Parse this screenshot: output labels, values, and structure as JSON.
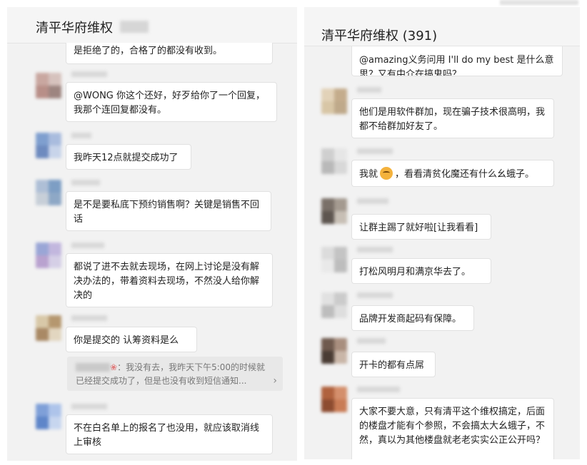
{
  "left_chat": {
    "title": "清平华府维权",
    "messages": [
      {
        "text": "是拒绝了的，合格了的都没有收到。"
      },
      {
        "text": "@WONG 你这个还好，好歹给你了一个回复，我那个连回复都没有。"
      },
      {
        "text": "我昨天12点就提交成功了"
      },
      {
        "text": "是不是要私底下预约销售啊？关键是销售不回话"
      },
      {
        "text": "都说了进不去就去现场，在网上讨论是没有解决办法的，带着资料去现场，不然没人给你解决的"
      },
      {
        "text": "你是提交的 认筹资料是么"
      },
      {
        "text": "不在白名单上的报名了也没用，就应该取消线上审核"
      }
    ],
    "quote": {
      "text": "：我没有去，我昨天下午5:00的时候就已经提交成功了，但是也没有收到短信通知...",
      "flower": "❀",
      "arrow": "›"
    }
  },
  "right_chat": {
    "title": "清平华府维权 (391)",
    "messages": [
      {
        "text": "@amazing义务问用 I'll do my best 是什么意思？又有中介在搞鬼吗？"
      },
      {
        "text": "他们是用软件群加，现在骗子技术很高明，我都不给群加好友了。"
      },
      {
        "text_before": "我就",
        "text_after": "，看看清贫化魔还有什么幺蛾子。",
        "emoji": "smirk-emoji"
      },
      {
        "text": "让群主踢了就好啦[让我看看]"
      },
      {
        "text": "打松风明月和满京华去了。"
      },
      {
        "text": "品牌开发商起码有保障。"
      },
      {
        "text": "开卡的都有点屌"
      },
      {
        "text": "大家不要大意，只有清平这个维权搞定，后面的楼盘才能有个参照，不会搞太大幺蛾子，不然，真以为其他楼盘就老老实实公正公开吗？"
      }
    ]
  }
}
